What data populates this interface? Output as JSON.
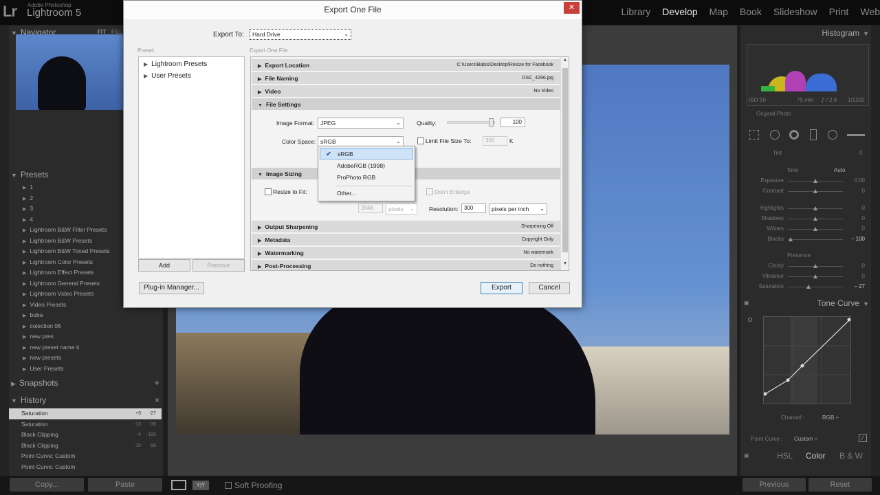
{
  "app": {
    "brand_small": "Adobe Photoshop",
    "brand_name": "Lightroom 5",
    "logo": "Lr",
    "modules": [
      "Library",
      "Develop",
      "Map",
      "Book",
      "Slideshow",
      "Print",
      "Web"
    ],
    "active_module": "Develop"
  },
  "left_panel": {
    "navigator": {
      "title": "Navigator",
      "fit": "FIT",
      "fill": "FILL"
    },
    "presets": {
      "title": "Presets",
      "items": [
        "1",
        "2",
        "3",
        "4",
        "Lightroom B&W Filter Presets",
        "Lightroom B&W Presets",
        "Lightroom B&W Toned Presets",
        "Lightroom Color Presets",
        "Lightroom Effect Presets",
        "Lightroom General Presets",
        "Lightroom Video Presets",
        "Video Presets",
        "buba",
        "colection 06",
        "new pres",
        "new preset name it",
        "new presets",
        "User Presets"
      ]
    },
    "snapshots": {
      "title": "Snapshots",
      "action": "+"
    },
    "history": {
      "title": "History",
      "action": "×",
      "items": [
        {
          "label": "Saturation",
          "v1": "+9",
          "v2": "-27",
          "selected": true
        },
        {
          "label": "Saturation",
          "v1": "-13",
          "v2": "-36",
          "selected": false
        },
        {
          "label": "Black Clipping",
          "v1": "-4",
          "v2": "-100",
          "selected": false
        },
        {
          "label": "Black Clipping",
          "v1": "-10",
          "v2": "-96",
          "selected": false
        },
        {
          "label": "Point Curve: Custom",
          "v1": "",
          "v2": "",
          "selected": false
        },
        {
          "label": "Point Curve: Custom",
          "v1": "",
          "v2": "",
          "selected": false
        }
      ]
    },
    "copy_button": "Copy...",
    "paste_button": "Paste"
  },
  "toolbar": {
    "soft_proofing": "Soft Proofing",
    "view_compare": "Y|Y"
  },
  "right_panel": {
    "histogram_title": "Histogram",
    "exif": {
      "iso": "ISO 50",
      "focal": "75 mm",
      "aperture": "ƒ / 2.8",
      "shutter": "1/1250"
    },
    "original_photo": "Original Photo",
    "tint_label": "Tint",
    "tint_value": "0",
    "tone_label": "Tone",
    "tone_auto": "Auto",
    "tone_sliders": [
      {
        "label": "Exposure",
        "value": "0.00"
      },
      {
        "label": "Contrast",
        "value": "0"
      },
      {
        "label": "Highlights",
        "value": "0"
      },
      {
        "label": "Shadows",
        "value": "0"
      },
      {
        "label": "Whites",
        "value": "0"
      },
      {
        "label": "Blacks",
        "value": "− 100"
      }
    ],
    "presence_label": "Presence",
    "presence_sliders": [
      {
        "label": "Clarity",
        "value": "0"
      },
      {
        "label": "Vibrance",
        "value": "0"
      },
      {
        "label": "Saturation",
        "value": "− 27"
      }
    ],
    "tone_curve_title": "Tone Curve",
    "channel_label": "Channel :",
    "channel_value": "RGB ÷",
    "point_curve_label": "Point Curve :",
    "point_curve_value": "Custom ÷",
    "hsl_tabs": [
      "HSL",
      "Color",
      "B & W"
    ],
    "previous_button": "Previous",
    "reset_button": "Reset"
  },
  "dialog": {
    "title": "Export One File",
    "close": "✕",
    "export_to_label": "Export To:",
    "export_to_value": "Hard Drive",
    "preset_label": "Preset:",
    "settings_label": "Export One File",
    "preset_tree": [
      "Lightroom Presets",
      "User Presets"
    ],
    "add_button": "Add",
    "remove_button": "Remove",
    "plugin_manager_button": "Plug-in Manager...",
    "export_button": "Export",
    "cancel_button": "Cancel",
    "sections": [
      {
        "title": "Export Location",
        "summary": "C:\\Users\\Babis\\Desktop\\Resize for Facebook"
      },
      {
        "title": "File Naming",
        "summary": "DSC_4296.jpg"
      },
      {
        "title": "Video",
        "summary": "No Video"
      },
      {
        "title": "File Settings",
        "summary": ""
      },
      {
        "title": "Image Sizing",
        "summary": ""
      },
      {
        "title": "Output Sharpening",
        "summary": "Sharpening Off"
      },
      {
        "title": "Metadata",
        "summary": "Copyright Only"
      },
      {
        "title": "Watermarking",
        "summary": "No watermark"
      },
      {
        "title": "Post-Processing",
        "summary": "Do nothing"
      }
    ],
    "file_settings": {
      "image_format_label": "Image Format:",
      "image_format_value": "JPEG",
      "quality_label": "Quality:",
      "quality_value": "100",
      "quality_level": 1.0,
      "color_space_label": "Color Space:",
      "color_space_value": "sRGB",
      "limit_label": "Limit File Size To:",
      "limit_value": "300",
      "limit_unit": "K"
    },
    "image_sizing": {
      "resize_label": "Resize to Fit:",
      "dont_enlarge_label": "Don't Enlarge",
      "size_value": "2048",
      "size_unit": "pixels",
      "resolution_label": "Resolution:",
      "resolution_value": "300",
      "resolution_unit": "pixels per inch"
    },
    "color_space_menu": {
      "items": [
        "sRGB",
        "AdobeRGB (1998)",
        "ProPhoto RGB",
        "Other..."
      ],
      "checked": "sRGB"
    }
  }
}
